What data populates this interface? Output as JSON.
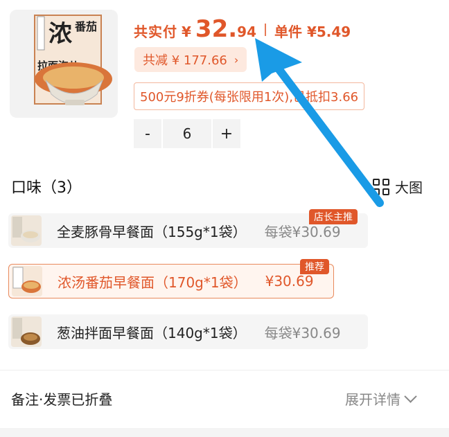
{
  "product": {
    "image_icon": "noodle-package",
    "pkg_text": "浓",
    "pkg_sub": "番茄",
    "pkg_bottom": "拉面泡儿"
  },
  "price": {
    "label": "共实付",
    "currency": "¥",
    "integer": "32.",
    "decimal": "94",
    "unit_price": "单件 ¥5.49"
  },
  "discount": {
    "text": "共减 ¥ 177.66",
    "chevron": "›"
  },
  "coupon": {
    "text": "500元9折券(每张限用1次),已抵扣3.66"
  },
  "quantity": {
    "minus": "-",
    "value": "6",
    "plus": "+"
  },
  "flavors": {
    "title": "口味（3）",
    "big_view": "大图",
    "options": [
      {
        "name": "全麦豚骨早餐面（155g*1袋）",
        "price": "每袋¥30.69",
        "tag": "店长主推",
        "selected": false
      },
      {
        "name": "浓汤番茄早餐面（170g*1袋）",
        "price": "¥30.69",
        "tag": "推荐",
        "selected": true
      },
      {
        "name": "葱油拌面早餐面（140g*1袋）",
        "price": "每袋¥30.69",
        "tag": "",
        "selected": false
      }
    ]
  },
  "footer": {
    "left": "备注·发票已折叠",
    "right": "展开详情"
  },
  "colors": {
    "accent": "#e0572a",
    "arrow": "#1a9be6"
  }
}
